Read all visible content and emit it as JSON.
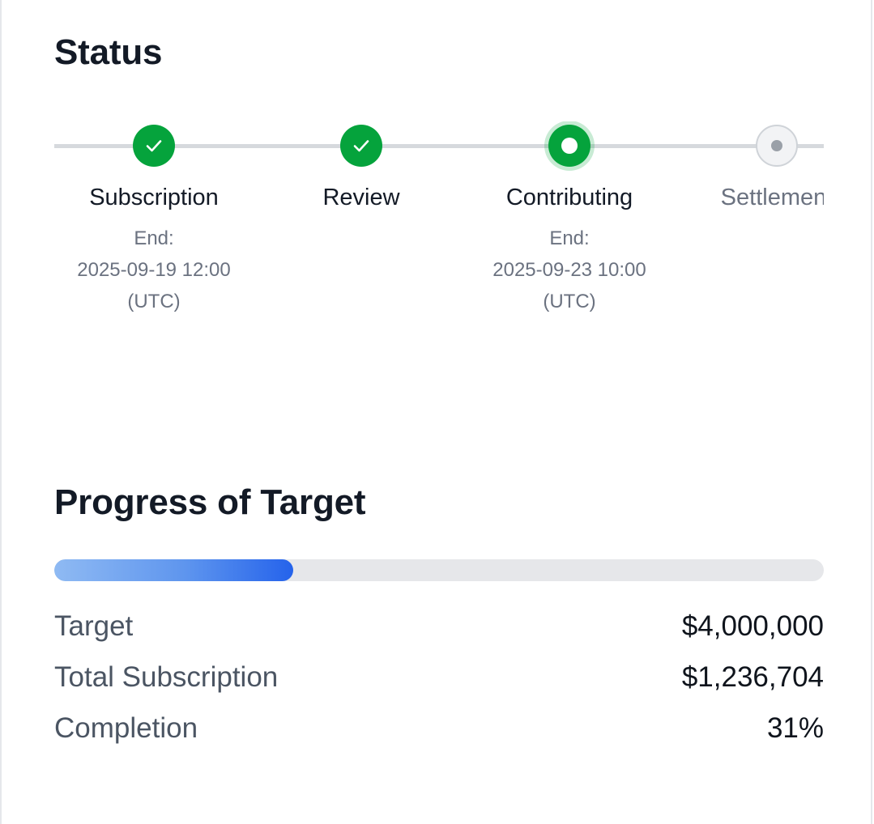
{
  "status": {
    "title": "Status",
    "steps": [
      {
        "label": "Subscription",
        "state": "done",
        "icon": "checkmark-icon",
        "detail_lines": [
          "End:",
          "2025-09-19 12:00",
          "(UTC)"
        ]
      },
      {
        "label": "Review",
        "state": "done",
        "icon": "checkmark-icon",
        "detail_lines": []
      },
      {
        "label": "Contributing",
        "state": "active",
        "icon": "active-dot-icon",
        "detail_lines": [
          "End:",
          "2025-09-23 10:00",
          "(UTC)"
        ]
      },
      {
        "label": "Settlement",
        "state": "pending",
        "icon": "pending-dot-icon",
        "detail_lines": []
      }
    ]
  },
  "progress": {
    "title": "Progress of Target",
    "fraction": 0.31,
    "rows": {
      "target": {
        "label": "Target",
        "value": "$4,000,000"
      },
      "total_subscription": {
        "label": "Total Subscription",
        "value": "$1,236,704"
      },
      "completion": {
        "label": "Completion",
        "value": "31%"
      }
    }
  },
  "colors": {
    "done": "#05a33c",
    "active": "#05a33c",
    "pending": "#9aa0a8",
    "bar_fill_end": "#2563eb",
    "bar_track": "#e6e7ea"
  }
}
